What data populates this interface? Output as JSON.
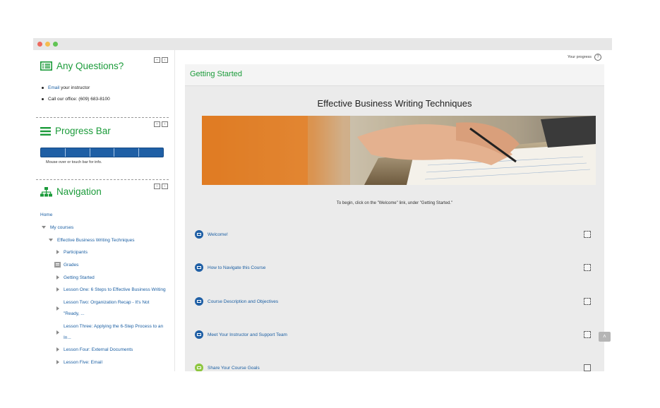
{
  "questions_block": {
    "title": "Any Questions?",
    "email_link": "Email",
    "email_rest": " your instructor",
    "office": "Call our office: (609) 683-8100"
  },
  "progress_block": {
    "title": "Progress Bar",
    "info": "Mouse over or touch bar for info.",
    "segments": 5
  },
  "navigation_block": {
    "title": "Navigation",
    "home": "Home",
    "my_courses": "My courses",
    "course": "Effective Business Writing Techniques",
    "items": [
      "Participants",
      "Grades",
      "Getting Started",
      "Lesson One: 6 Steps to Effective Business Writing",
      "Lesson Two: Organization Recap - It's Not",
      "\"Ready, ...",
      "Lesson Three: Applying the 6-Step Process to an",
      "In...",
      "Lesson Four: External Documents",
      "Lesson Five: Email"
    ]
  },
  "header": {
    "your_progress": "Your progress"
  },
  "main": {
    "section_title": "Getting Started",
    "course_title": "Effective Business Writing Techniques",
    "intro": "To begin, click on the \"Welcome\" link, under \"Getting Started.\"",
    "activities": [
      {
        "label": "Welcome!",
        "icon": "page-icon"
      },
      {
        "label": "How to Navigate this Course",
        "icon": "page-icon"
      },
      {
        "label": "Course Description and Objectives",
        "icon": "page-icon"
      },
      {
        "label": "Meet Your Instructor and Support Team",
        "icon": "page-icon"
      },
      {
        "label": "Share Your Course Goals",
        "icon": "forum-icon"
      }
    ]
  },
  "colors": {
    "accent_green": "#1b9b3a",
    "link_blue": "#1b5fa3",
    "bar_blue": "#1f5fa5"
  }
}
